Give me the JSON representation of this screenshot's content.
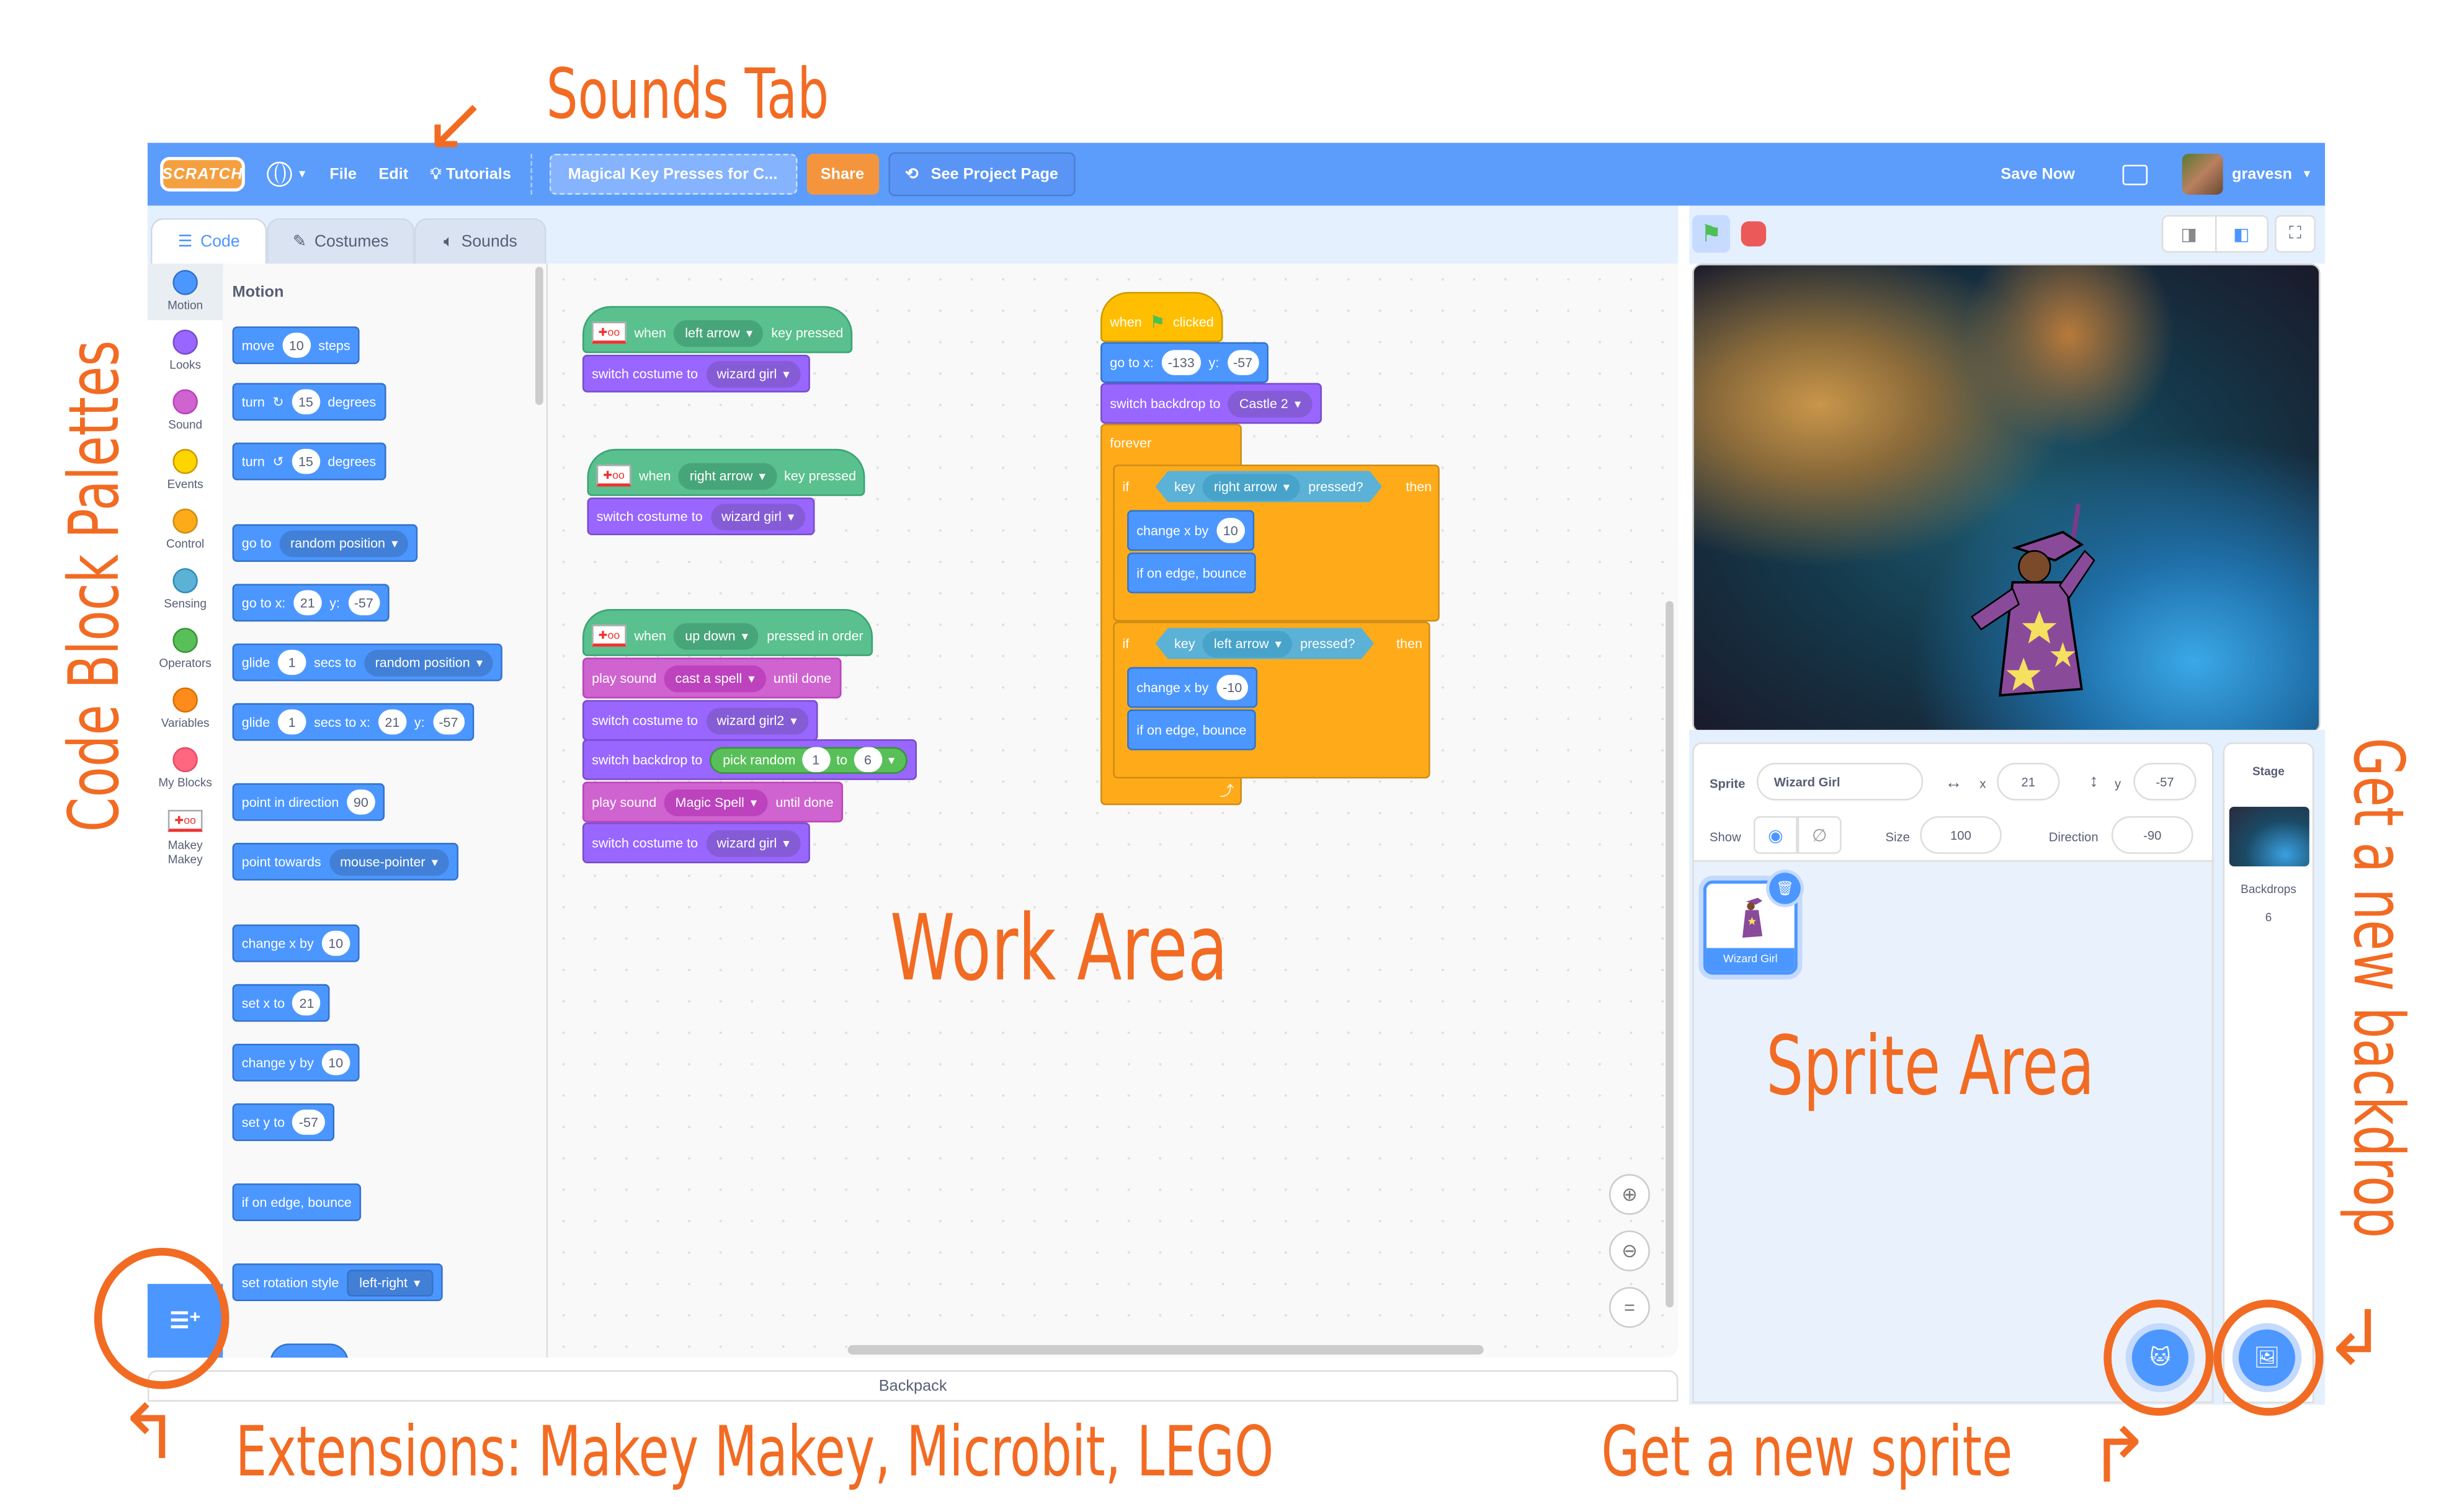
{
  "header": {
    "logo": "SCRATCH",
    "language_icon": "globe-icon",
    "menu": [
      "File",
      "Edit",
      "Tutorials"
    ],
    "project_title": "Magical Key Presses for C...",
    "share_label": "Share",
    "see_project_label": "See Project Page",
    "save_label": "Save Now",
    "username": "gravesn"
  },
  "tabs": [
    {
      "label": "Code",
      "active": true
    },
    {
      "label": "Costumes",
      "active": false
    },
    {
      "label": "Sounds",
      "active": false
    }
  ],
  "categories": [
    {
      "label": "Motion",
      "color": "#4c97ff",
      "selected": true
    },
    {
      "label": "Looks",
      "color": "#9966ff"
    },
    {
      "label": "Sound",
      "color": "#cf63cf"
    },
    {
      "label": "Events",
      "color": "#ffd500"
    },
    {
      "label": "Control",
      "color": "#ffab19"
    },
    {
      "label": "Sensing",
      "color": "#5cb1d6"
    },
    {
      "label": "Operators",
      "color": "#59c059"
    },
    {
      "label": "Variables",
      "color": "#ff8c1a"
    },
    {
      "label": "My Blocks",
      "color": "#ff6680"
    },
    {
      "label": "Makey Makey",
      "color": ""
    }
  ],
  "palette": {
    "title": "Motion",
    "blocks": {
      "move": {
        "a": "move",
        "v": "10",
        "b": "steps"
      },
      "turn_cw": {
        "a": "turn",
        "v": "15",
        "b": "degrees"
      },
      "turn_ccw": {
        "a": "turn",
        "v": "15",
        "b": "degrees"
      },
      "goto": {
        "a": "go to",
        "d": "random position"
      },
      "gotoxy": {
        "a": "go to x:",
        "x": "21",
        "yl": "y:",
        "y": "-57"
      },
      "glide": {
        "a": "glide",
        "v": "1",
        "b": "secs to",
        "d": "random position"
      },
      "glidexy": {
        "a": "glide",
        "v": "1",
        "b": "secs to x:",
        "x": "21",
        "yl": "y:",
        "y": "-57"
      },
      "point_dir": {
        "a": "point in direction",
        "v": "90"
      },
      "point_towards": {
        "a": "point towards",
        "d": "mouse-pointer"
      },
      "change_x": {
        "a": "change x by",
        "v": "10"
      },
      "set_x": {
        "a": "set x to",
        "v": "21"
      },
      "change_y": {
        "a": "change y by",
        "v": "10"
      },
      "set_y": {
        "a": "set y to",
        "v": "-57"
      },
      "bounce": {
        "a": "if on edge, bounce"
      },
      "rotation": {
        "a": "set rotation style",
        "d": "left-right"
      }
    }
  },
  "scripts": {
    "s1": {
      "when": "when",
      "key": "left arrow",
      "tail": "key pressed",
      "costume_label": "switch costume to",
      "costume": "wizard girl"
    },
    "s2": {
      "when": "when",
      "key": "right arrow",
      "tail": "key pressed",
      "costume_label": "switch costume to",
      "costume": "wizard girl"
    },
    "s3": {
      "when": "when",
      "key": "up down",
      "tail": "pressed in order",
      "play1_label": "play sound",
      "sound1": "cast a spell",
      "until": "until done",
      "costume_label": "switch costume to",
      "costume1": "wizard girl2",
      "backdrop_label": "switch backdrop to",
      "random_label": "pick random",
      "from": "1",
      "to_label": "to",
      "to": "6",
      "play2_label": "play sound",
      "sound2": "Magic Spell",
      "costume2": "wizard girl"
    },
    "s4": {
      "when": "when",
      "clicked": "clicked",
      "goto_label": "go to x:",
      "x": "-133",
      "y_label": "y:",
      "y": "-57",
      "backdrop_label": "switch backdrop to",
      "backdrop": "Castle 2",
      "forever": "forever",
      "if": "if",
      "key_label": "key",
      "pressed": "pressed?",
      "then": "then",
      "key1": "right arrow",
      "change_label": "change x by",
      "dx1": "10",
      "bounce": "if on edge, bounce",
      "key2": "left arrow",
      "dx2": "-10"
    }
  },
  "backpack_label": "Backpack",
  "sprite_info": {
    "sprite_label": "Sprite",
    "sprite_name": "Wizard Girl",
    "x_label": "x",
    "x": "21",
    "y_label": "y",
    "y": "-57",
    "show_label": "Show",
    "size_label": "Size",
    "size": "100",
    "direction_label": "Direction",
    "direction": "-90"
  },
  "sprites": [
    {
      "name": "Wizard Girl",
      "selected": true
    }
  ],
  "stage_pane": {
    "title": "Stage",
    "backdrops_label": "Backdrops",
    "backdrops_count": "6"
  },
  "annotations": {
    "sounds_tab": "Sounds Tab",
    "palettes": "Code Block Palettes",
    "work_area": "Work Area",
    "sprite_area": "Sprite Area",
    "new_backdrop": "Get a new backdrop",
    "extensions": "Extensions: Makey Makey, Microbit, LEGO",
    "new_sprite": "Get a new sprite"
  },
  "colors": {
    "accent": "#4c97ff",
    "annotation": "#f26b23",
    "share": "#f4953e"
  }
}
